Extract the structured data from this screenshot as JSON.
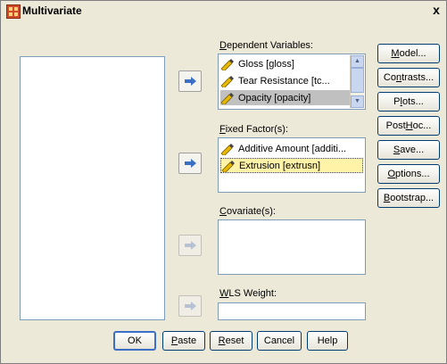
{
  "window": {
    "title": "Multivariate",
    "close_glyph": "x"
  },
  "icons": {
    "arrow": "right-arrow-icon",
    "variable": "ruler-pencil-icon",
    "app": "spss-app-icon"
  },
  "dependent": {
    "label_pre": "",
    "label_key": "D",
    "label_post": "ependent Variables:",
    "items": [
      "Gloss [gloss]",
      "Tear Resistance [tc...",
      "Opacity [opacity]"
    ]
  },
  "fixed": {
    "label_pre": "",
    "label_key": "F",
    "label_post": "ixed Factor(s):",
    "items": [
      "Additive Amount [additi...",
      "Extrusion [extrusn]"
    ]
  },
  "covariate": {
    "label_pre": "",
    "label_key": "C",
    "label_post": "ovariate(s):"
  },
  "wls": {
    "label_pre": "",
    "label_key": "W",
    "label_post": "LS Weight:"
  },
  "side_buttons": [
    {
      "pre": "",
      "key": "M",
      "post": "odel..."
    },
    {
      "pre": "Co",
      "key": "n",
      "post": "trasts..."
    },
    {
      "pre": "P",
      "key": "l",
      "post": "ots..."
    },
    {
      "pre": "Post ",
      "key": "H",
      "post": "oc..."
    },
    {
      "pre": "",
      "key": "S",
      "post": "ave..."
    },
    {
      "pre": "",
      "key": "O",
      "post": "ptions..."
    },
    {
      "pre": "",
      "key": "B",
      "post": "ootstrap..."
    }
  ],
  "bottom_buttons": [
    {
      "pre": "OK",
      "key": "",
      "post": ""
    },
    {
      "pre": "",
      "key": "P",
      "post": "aste"
    },
    {
      "pre": "",
      "key": "R",
      "post": "eset"
    },
    {
      "pre": "Cancel",
      "key": "",
      "post": ""
    },
    {
      "pre": "Help",
      "key": "",
      "post": ""
    }
  ],
  "colors": {
    "selected_gray": "#c0c0c0",
    "selected_yellow": "#fff3a8",
    "button_border": "#003c74",
    "arrow_blue": "#3b6fc4"
  }
}
